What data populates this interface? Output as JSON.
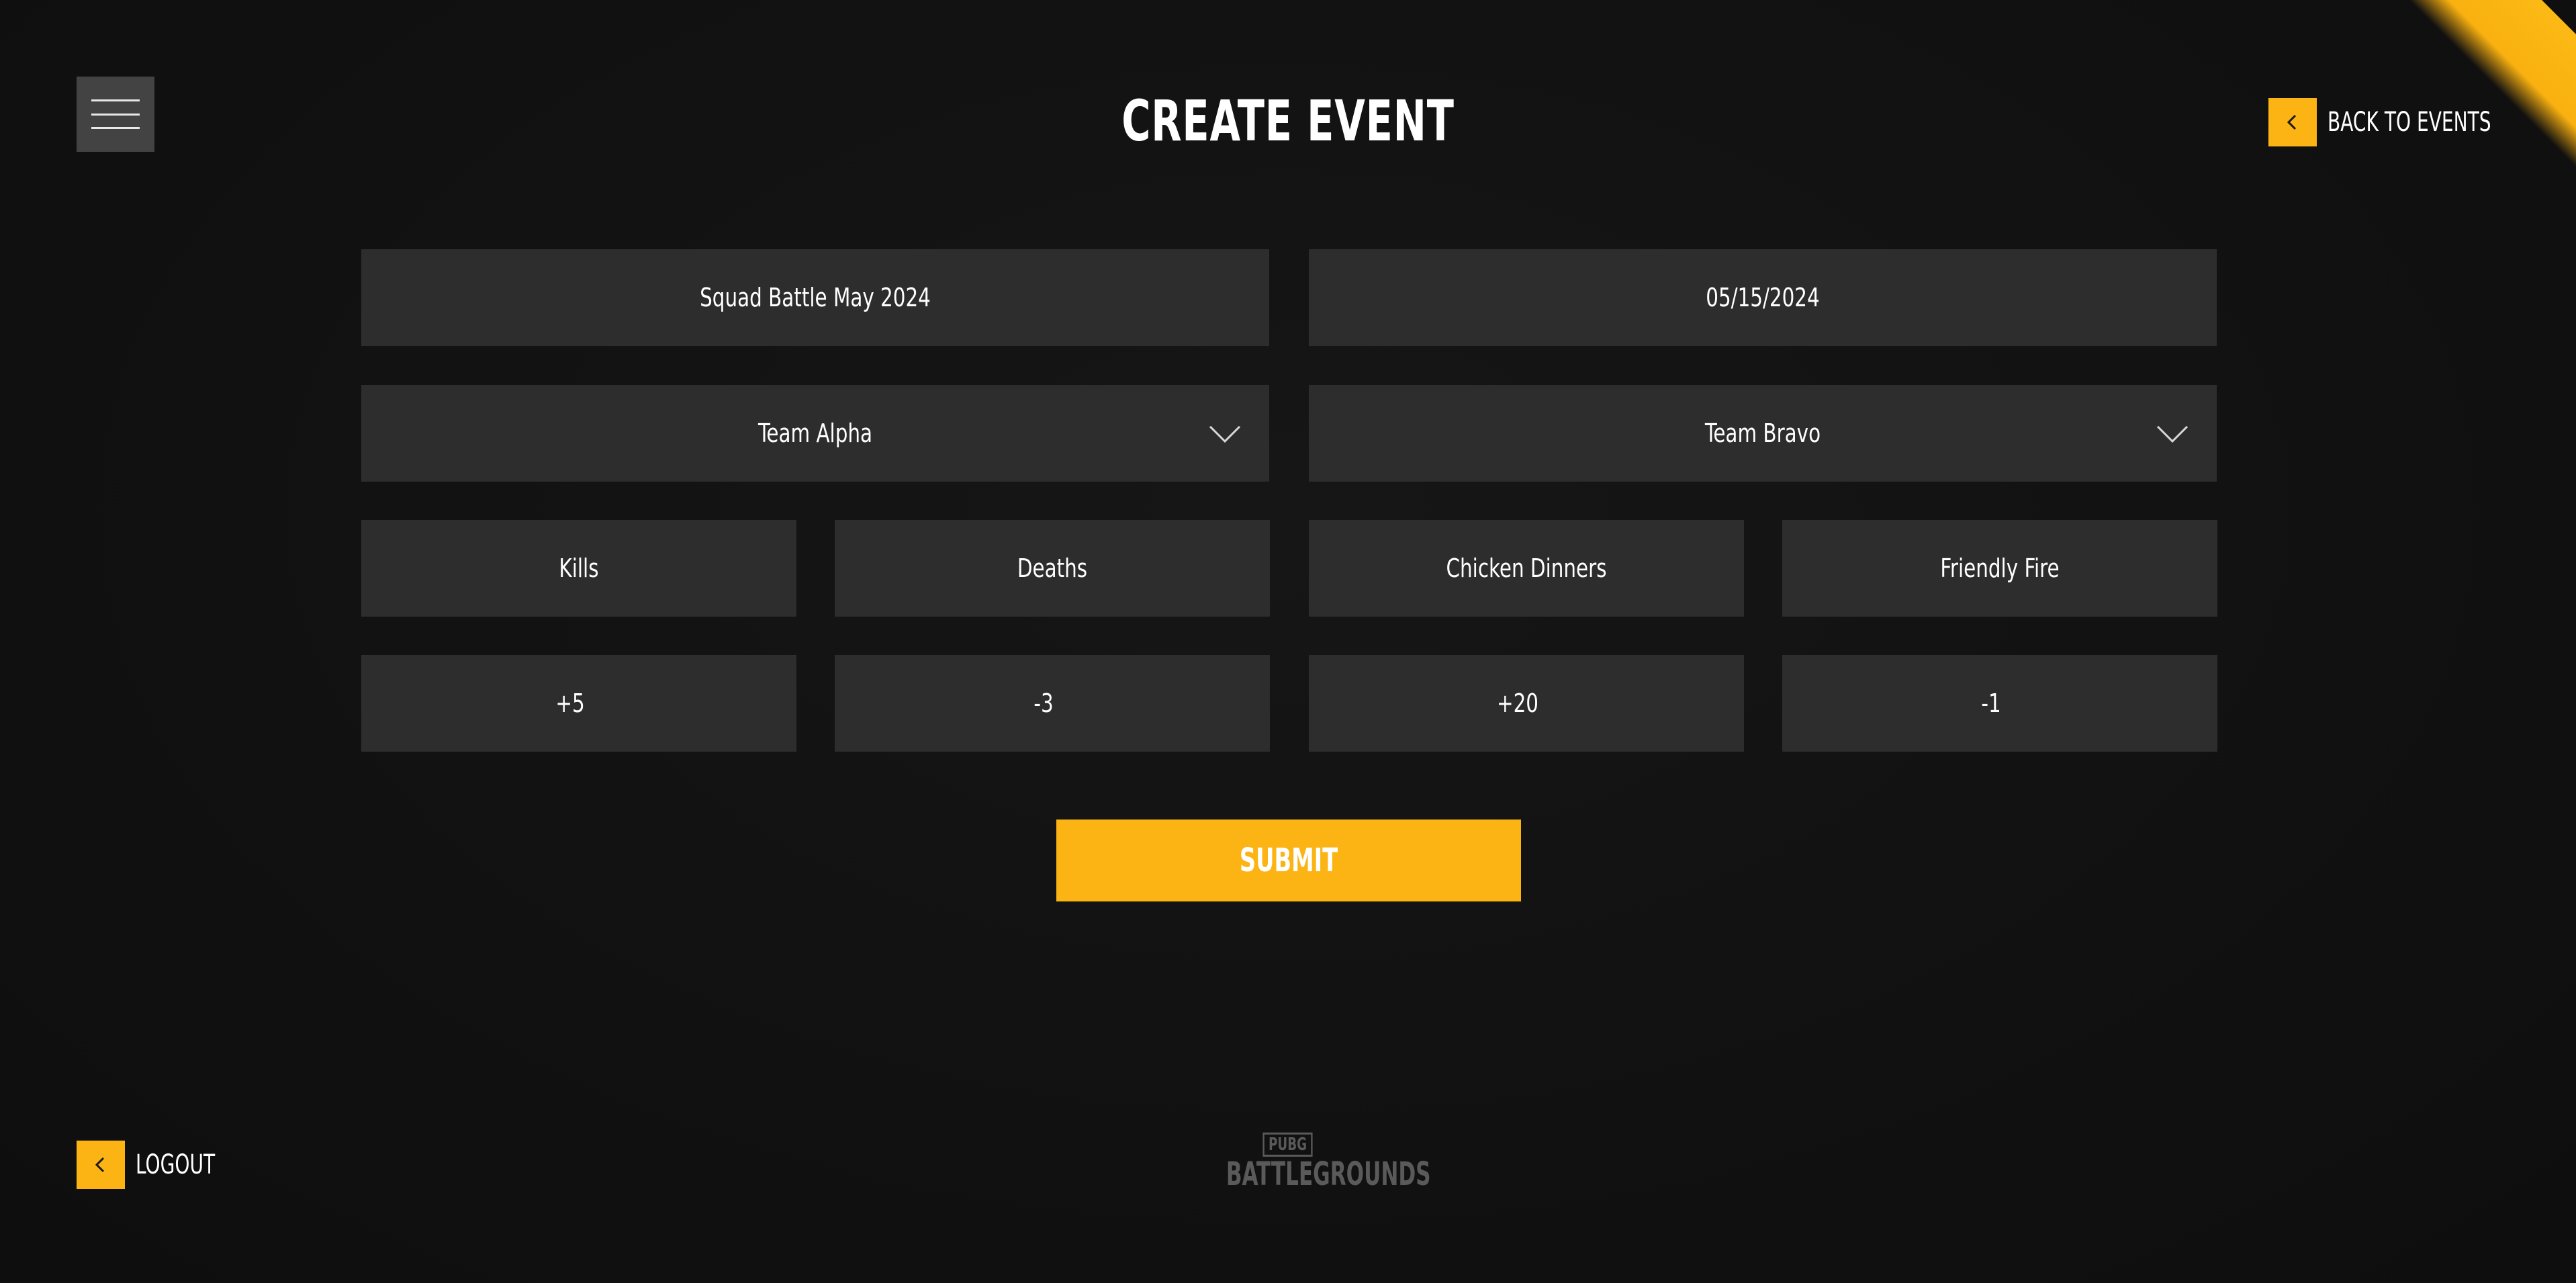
{
  "header": {
    "title": "CREATE EVENT",
    "back_label": "BACK TO EVENTS",
    "menu_icon": "hamburger-menu-icon"
  },
  "form": {
    "event_name": "Squad Battle May 2024",
    "event_date": "05/15/2024",
    "team_one": "Team Alpha",
    "team_two": "Team Bravo",
    "stats": [
      {
        "label": "Kills",
        "points": "+5"
      },
      {
        "label": "Deaths",
        "points": "-3"
      },
      {
        "label": "Chicken Dinners",
        "points": "+20"
      },
      {
        "label": "Friendly Fire",
        "points": "-1"
      }
    ],
    "submit_label": "SUBMIT"
  },
  "footer": {
    "logout_label": "LOGOUT",
    "brand_top": "PUBG",
    "brand_bottom": "BATTLEGROUNDS"
  },
  "colors": {
    "background": "#121212",
    "field": "#2d2d2d",
    "accent": "#fbb414",
    "menu_button": "#434343",
    "text": "#ffffff"
  }
}
